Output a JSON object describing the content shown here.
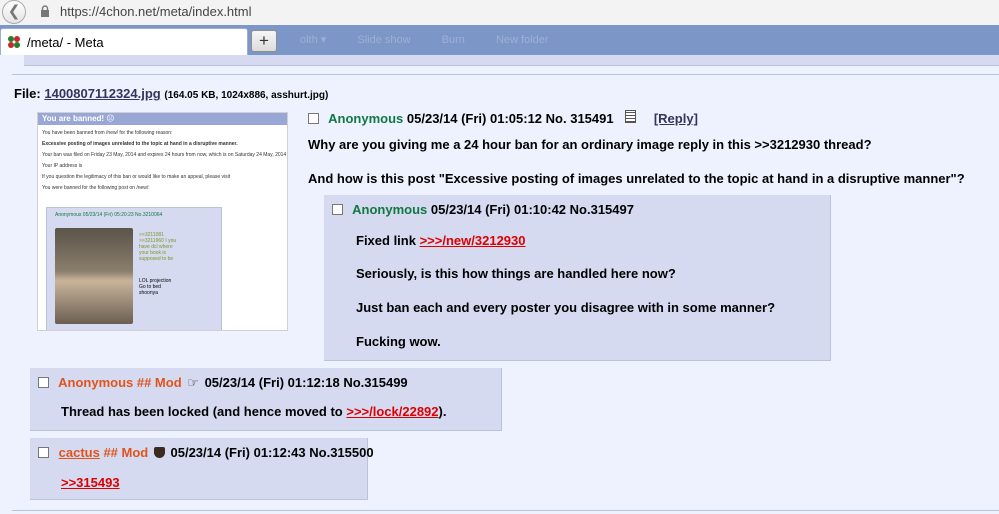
{
  "browser": {
    "url": "https://4chon.net/meta/index.html",
    "tab_title": "/meta/ - Meta",
    "new_tab": "+",
    "faded_nav": [
      "olth ▾",
      "Slide show",
      "Burn",
      "New folder"
    ]
  },
  "op": {
    "file_label": "File:",
    "file_name": "1400807112324.jpg",
    "file_info": "(164.05 KB, 1024x886, asshurt.jpg)",
    "thumbnail": {
      "banner": "You are banned! ☹",
      "lines": [
        "You have been banned from /new/ for the following reason:",
        "Excessive posting of images unrelated to the topic at hand in a disruptive manner.",
        "Your ban was filed on Friday 23 May, 2014 and expires 24 hours from now, which is on Saturday 24 May, 2014",
        "Your IP address is",
        "If you question the legitimacy of this ban or would like to make an appeal, please visit",
        "You were banned for the following post on /new/:"
      ],
      "inner_header": "Anonymous 05/23/14 (Fri) 05:20:23 No.3210064",
      "inner_quotes": ">>3211081 >>3211960 I you have dcl where your book is supposed to be",
      "inner_text": "LOL projection  Go to bed shoonya"
    },
    "name": "Anonymous",
    "datetime": "05/23/14 (Fri) 01:05:12",
    "number": "No. 315491",
    "reply_link": "[Reply]",
    "message_line1": "Why are you giving me a 24 hour ban for an ordinary image reply in this >>3212930 thread?",
    "message_line2": "And how is this post \"Excessive posting of images unrelated to the topic at hand in a disruptive manner\"?"
  },
  "replies": [
    {
      "name": "Anonymous",
      "datetime": "05/23/14 (Fri) 01:10:42",
      "number": "No.315497",
      "fixed_label": "Fixed link",
      "fixed_link": ">>>/new/3212930",
      "line2": "Seriously, is this how things are handled here now?",
      "line3": "Just ban each and every poster you disagree with in some manner?",
      "line4": "Fucking wow."
    },
    {
      "name": "Anonymous ## Mod",
      "datetime": "05/23/14 (Fri) 01:12:18",
      "number": "No.315499",
      "text_before": "Thread has been locked (and hence moved to",
      "link": ">>>/lock/22892",
      "text_after": ")."
    },
    {
      "name": "cactus",
      "capcode": "## Mod",
      "datetime": "05/23/14 (Fri) 01:12:43",
      "number": "No.315500",
      "link": ">>315493"
    }
  ],
  "icons": {
    "back": "back-arrow-icon",
    "lock": "lock-icon",
    "tab_favicon": "clover-icon",
    "qr": "qr-code-icon",
    "mod_hand": "pointing-hand-icon",
    "mod_badge": "shield-icon"
  },
  "colors": {
    "page_bg": "#eef2ff",
    "reply_bg": "#d6daf0",
    "name_green": "#117743",
    "mod_orange": "#e0541c",
    "quote_red": "#dd0000",
    "link_blue": "#34345c"
  }
}
